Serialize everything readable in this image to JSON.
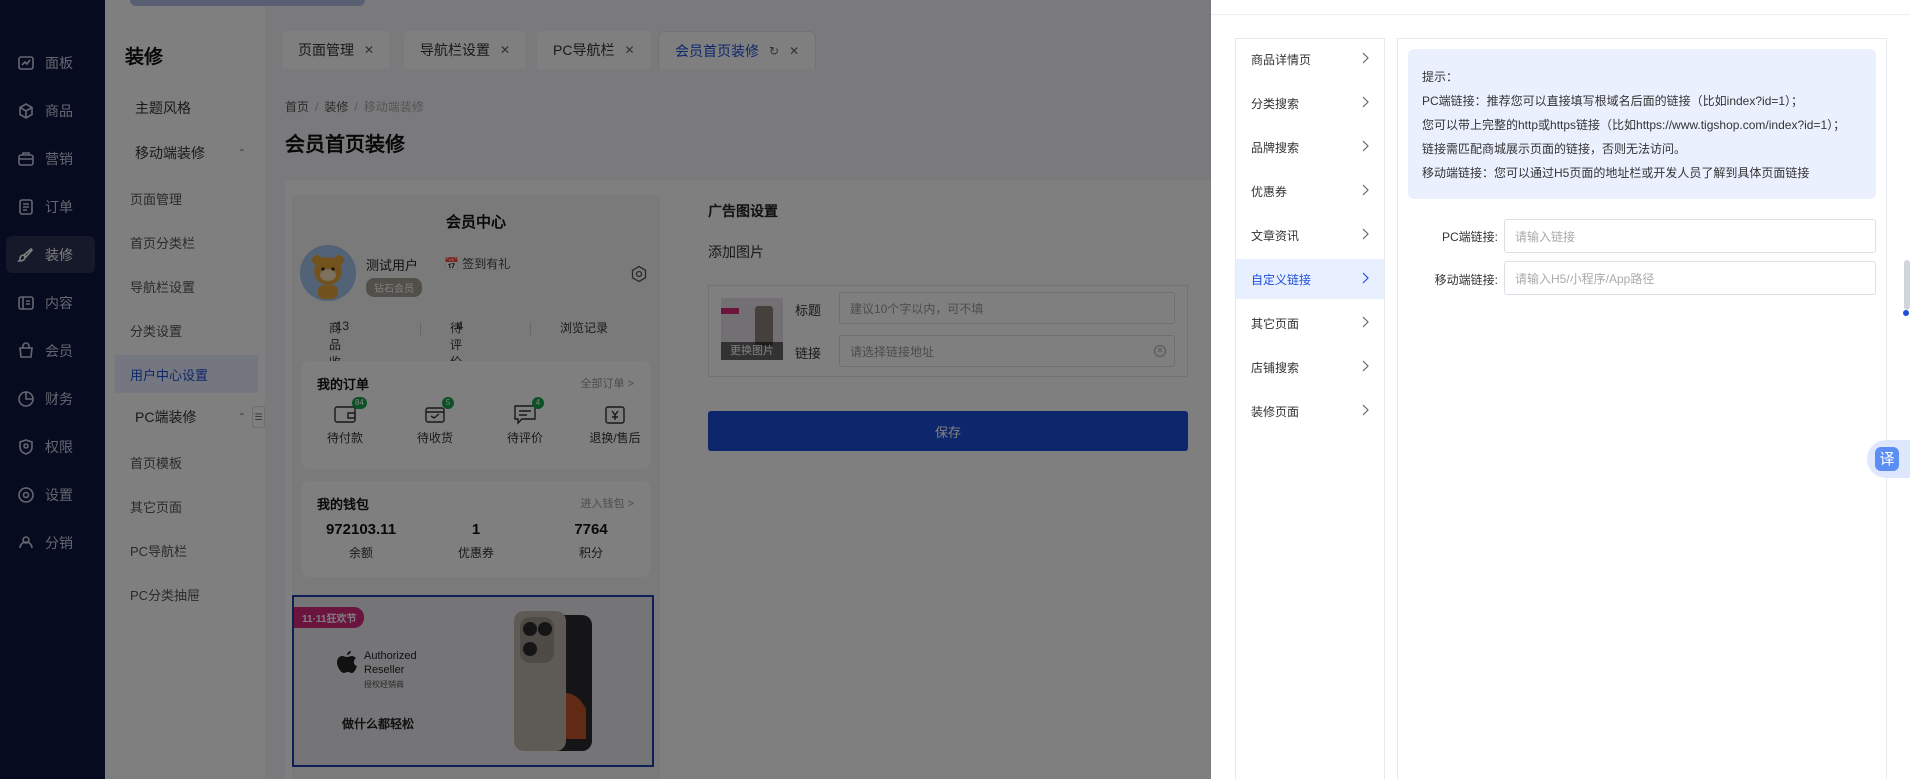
{
  "sidebar": {
    "items": [
      {
        "label": "面板",
        "icon": "dashboard-icon"
      },
      {
        "label": "商品",
        "icon": "box-icon"
      },
      {
        "label": "营销",
        "icon": "campaign-icon"
      },
      {
        "label": "订单",
        "icon": "order-icon"
      },
      {
        "label": "装修",
        "icon": "brush-icon",
        "active": true
      },
      {
        "label": "内容",
        "icon": "content-icon"
      },
      {
        "label": "会员",
        "icon": "member-icon"
      },
      {
        "label": "财务",
        "icon": "finance-icon"
      },
      {
        "label": "权限",
        "icon": "shield-icon"
      },
      {
        "label": "设置",
        "icon": "settings-icon"
      },
      {
        "label": "分销",
        "icon": "distribution-icon"
      }
    ]
  },
  "subnav": {
    "title": "装修",
    "items": [
      {
        "label": "主题风格"
      },
      {
        "label": "移动端装修"
      },
      {
        "label": "页面管理"
      },
      {
        "label": "首页分类栏"
      },
      {
        "label": "导航栏设置"
      },
      {
        "label": "分类设置"
      },
      {
        "label": "用户中心设置"
      },
      {
        "label": "PC端装修"
      },
      {
        "label": "首页模板"
      },
      {
        "label": "其它页面"
      },
      {
        "label": "PC导航栏"
      },
      {
        "label": "PC分类抽屉"
      }
    ]
  },
  "tabs": [
    {
      "label": "页面管理"
    },
    {
      "label": "导航栏设置"
    },
    {
      "label": "PC导航栏"
    },
    {
      "label": "会员首页装修"
    }
  ],
  "breadcrumb": [
    "首页",
    "/",
    "装修",
    "/",
    "移动端装修"
  ],
  "page_title": "会员首页装修",
  "preview": {
    "title": "会员中心",
    "username": "测试用户",
    "sign_in": "签到有礼",
    "level": "钻石会员",
    "stats": {
      "fav_label": "商品收藏",
      "fav_value": "13",
      "review_label": "待评价",
      "review_value": "4",
      "history_label": "浏览记录"
    },
    "orders": {
      "title": "我的订单",
      "more": "全部订单 >",
      "items": [
        {
          "label": "待付款",
          "count": "84"
        },
        {
          "label": "待收货",
          "count": "5"
        },
        {
          "label": "待评价",
          "count": "4"
        },
        {
          "label": "退换/售后"
        }
      ]
    },
    "wallet": {
      "title": "我的钱包",
      "more": "进入钱包 >",
      "items": [
        {
          "value": "972103.11",
          "label": "余额"
        },
        {
          "value": "1",
          "label": "优惠券"
        },
        {
          "value": "7764",
          "label": "积分"
        }
      ]
    },
    "ad": {
      "tag": "11·11狂欢节",
      "auth1": "Authorized",
      "auth2": "Reseller",
      "auth3": "授权经销商",
      "slogan": "做什么都轻松"
    }
  },
  "ad_settings": {
    "title": "广告图设置",
    "add_image": "添加图片",
    "change_image": "更换图片",
    "title_label": "标题",
    "title_placeholder": "建议10个字以内，可不填",
    "link_label": "链接",
    "link_placeholder": "请选择链接地址",
    "save": "保存"
  },
  "drawer": {
    "menu": [
      {
        "label": "商品详情页"
      },
      {
        "label": "分类搜索"
      },
      {
        "label": "品牌搜索"
      },
      {
        "label": "优惠券"
      },
      {
        "label": "文章资讯"
      },
      {
        "label": "自定义链接",
        "selected": true
      },
      {
        "label": "其它页面"
      },
      {
        "label": "店铺搜索"
      },
      {
        "label": "装修页面"
      }
    ],
    "tips": [
      "提示：",
      "PC端链接：推荐您可以直接填写根域名后面的链接（比如index?id=1）；",
      "您可以带上完整的http或https链接（比如https://www.tigshop.com/index?id=1）；",
      "链接需匹配商城展示页面的链接，否则无法访问。",
      "移动端链接：您可以通过H5页面的地址栏或开发人员了解到具体页面链接"
    ],
    "pc_label": "PC端链接:",
    "pc_placeholder": "请输入链接",
    "mobile_label": "移动端链接:",
    "mobile_placeholder": "请输入H5/小程序/App路径"
  },
  "translate_button": "译",
  "colors": {
    "brand": "#1d4fd8",
    "sidebar": "#0d1640",
    "tips_bg": "#ebf0ff"
  }
}
